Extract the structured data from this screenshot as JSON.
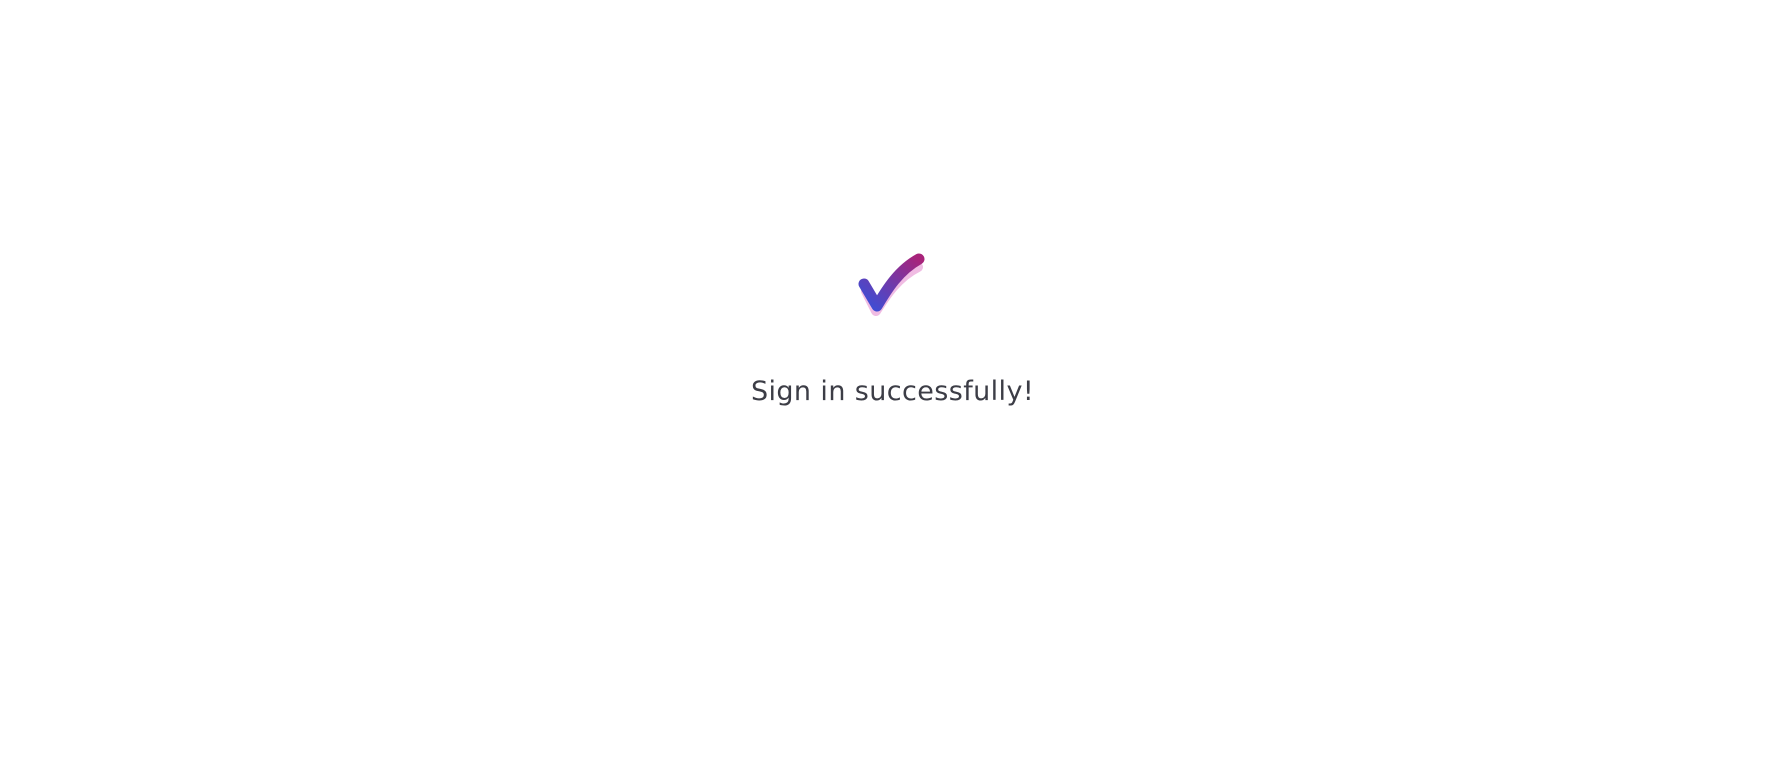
{
  "status": {
    "icon": "check-icon",
    "message": "Sign in successfully!",
    "colors": {
      "check_start": "#3a4fd8",
      "check_end": "#a8237a",
      "check_shadow": "#f0bce3",
      "text": "#3c3d46",
      "background": "#ffffff"
    }
  }
}
